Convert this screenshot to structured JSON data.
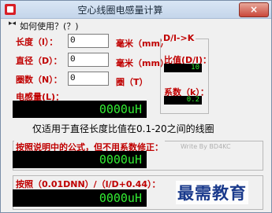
{
  "window": {
    "title": "空心线圈电感量计算",
    "close_label": "×"
  },
  "menu": {
    "arrow": "▸◂",
    "help": "如何使用？(？)"
  },
  "inputs": {
    "length_label": "长度（l）：",
    "length_value": "0",
    "length_unit": "毫米（mm）",
    "diameter_label": "直径（D）：",
    "diameter_value": "0",
    "diameter_unit": "毫米（mm）",
    "turns_label": "圈数（N）：",
    "turns_value": "0",
    "turns_unit": "圈（T）"
  },
  "ratio_group": {
    "title": "D/l->K",
    "ratio_label": "比值(D/l)：",
    "ratio_value": "10",
    "coef_label": "系数（k）：",
    "coef_value": "0.2"
  },
  "inductance": {
    "label": "电感量(L)：",
    "value": "0000uH"
  },
  "note": "仅适用于直径长度比值在0.1-20之间的线圈",
  "formula1": {
    "label": "按照说明中的公式，但不用系数修正：",
    "value": "0000uH",
    "credit": "Write By BD4KC"
  },
  "formula2": {
    "label": "按照（0.01DNN）/（l/D+0.44）：",
    "value": "0000uH"
  },
  "watermark": "最需教育",
  "colors": {
    "label_red": "#c00000",
    "lcd_green": "#33ee33",
    "lcd_bg": "#000000"
  }
}
